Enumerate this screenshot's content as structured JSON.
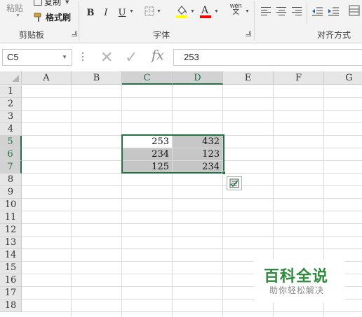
{
  "ribbon": {
    "clipboard": {
      "label": "剪贴板",
      "paste_label": "粘贴",
      "copy_label": "复制",
      "format_painter_label": "格式刷"
    },
    "font": {
      "label": "字体",
      "bold": "B",
      "italic": "I",
      "underline": "U",
      "phonetic_top": "wén",
      "phonetic_bottom": "文"
    },
    "alignment": {
      "label": "对齐方式"
    },
    "colors": {
      "highlight": "#ffff00",
      "font_color": "#ff0000",
      "accent": "#217346"
    }
  },
  "formula_bar": {
    "name_box": "C5",
    "cancel_glyph": "✕",
    "enter_glyph": "✓",
    "fx_label": "fx",
    "formula_value": "253"
  },
  "grid": {
    "columns": [
      "A",
      "B",
      "C",
      "D",
      "E",
      "F",
      "G"
    ],
    "selected_columns": [
      "C",
      "D"
    ],
    "rows": [
      "1",
      "2",
      "3",
      "4",
      "5",
      "6",
      "7",
      "8",
      "9",
      "10",
      "11",
      "12",
      "13",
      "14",
      "15",
      "16",
      "17",
      "18"
    ],
    "selected_rows": [
      "5",
      "6",
      "7"
    ],
    "selected_range": "C5:D7",
    "cells": {
      "C5": "253",
      "D5": "432",
      "C6": "234",
      "D6": "123",
      "C7": "125",
      "D7": "234"
    }
  },
  "watermark": {
    "title": "百科全说",
    "subtitle": "助你轻松解决"
  }
}
